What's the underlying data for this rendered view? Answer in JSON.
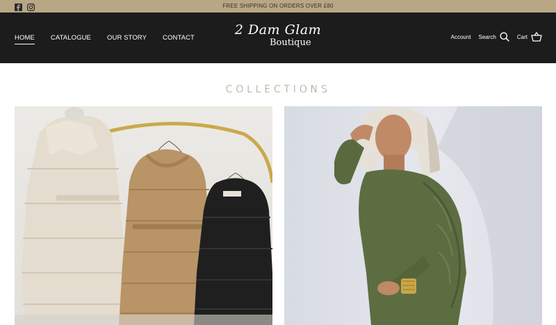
{
  "announcement": {
    "text": "FREE SHIPPING ON ORDERS OVER £80",
    "social": [
      "facebook-icon",
      "instagram-icon"
    ]
  },
  "header": {
    "nav": [
      "HOME",
      "CATALOGUE",
      "OUR STORY",
      "CONTACT"
    ],
    "active_nav": "HOME",
    "logo_line1": "2 Dam Glam",
    "logo_line2": "Boutique",
    "account_label": "Account",
    "search_label": "Search",
    "cart_label": "Cart"
  },
  "collections": {
    "title": "COLLECTIONS",
    "cards": [
      {
        "image": "puffer coats on rail"
      },
      {
        "image": "model in green velvet dress"
      }
    ]
  },
  "colors": {
    "announcement_bg": "#b8a685",
    "header_bg": "#1c1c1c",
    "title_color": "#8f8068"
  }
}
